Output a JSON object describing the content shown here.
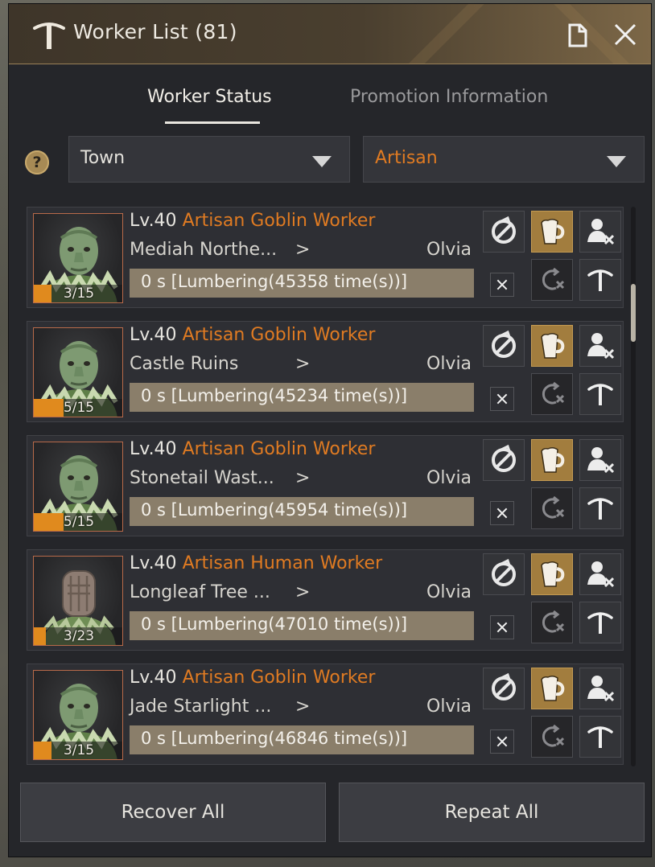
{
  "window": {
    "title": "Worker List (81)"
  },
  "tabs": [
    {
      "label": "Worker Status",
      "active": true
    },
    {
      "label": "Promotion Information",
      "active": false
    }
  ],
  "filters": {
    "help": "?",
    "town": "Town",
    "grade": "Artisan"
  },
  "colors": {
    "accent": "#e07b22",
    "gold": "#a27d3e",
    "panel": "#25262a"
  },
  "workers": [
    {
      "level": "Lv.40",
      "grade": "Artisan",
      "race": "Goblin Worker",
      "location": "Mediah Northe...",
      "arrow": ">",
      "town": "Olvia",
      "stamina": "3/15",
      "stamina_fraction": 0.2,
      "task": "0 s [Lumbering(45358 time(s))]",
      "portrait": "goblin"
    },
    {
      "level": "Lv.40",
      "grade": "Artisan",
      "race": "Goblin Worker",
      "location": "Castle Ruins",
      "arrow": ">",
      "town": "Olvia",
      "stamina": "5/15",
      "stamina_fraction": 0.33,
      "task": "0 s [Lumbering(45234 time(s))]",
      "portrait": "goblin"
    },
    {
      "level": "Lv.40",
      "grade": "Artisan",
      "race": "Goblin Worker",
      "location": "Stonetail Wast...",
      "arrow": ">",
      "town": "Olvia",
      "stamina": "5/15",
      "stamina_fraction": 0.33,
      "task": "0 s [Lumbering(45954 time(s))]",
      "portrait": "goblin"
    },
    {
      "level": "Lv.40",
      "grade": "Artisan",
      "race": "Human Worker",
      "location": "Longleaf Tree ...",
      "arrow": ">",
      "town": "Olvia",
      "stamina": "3/23",
      "stamina_fraction": 0.13,
      "task": "0 s [Lumbering(47010 time(s))]",
      "portrait": "human"
    },
    {
      "level": "Lv.40",
      "grade": "Artisan",
      "race": "Goblin Worker",
      "location": "Jade Starlight ...",
      "arrow": ">",
      "town": "Olvia",
      "stamina": "3/15",
      "stamina_fraction": 0.2,
      "task": "0 s [Lumbering(46846 time(s))]",
      "portrait": "goblin"
    }
  ],
  "row_buttons": [
    "no-upgrade-icon",
    "feed-beer-icon",
    "fire-worker-icon",
    "stop-repeat-icon",
    "pickaxe-icon"
  ],
  "footer": {
    "recover_all": "Recover All",
    "repeat_all": "Repeat All"
  }
}
